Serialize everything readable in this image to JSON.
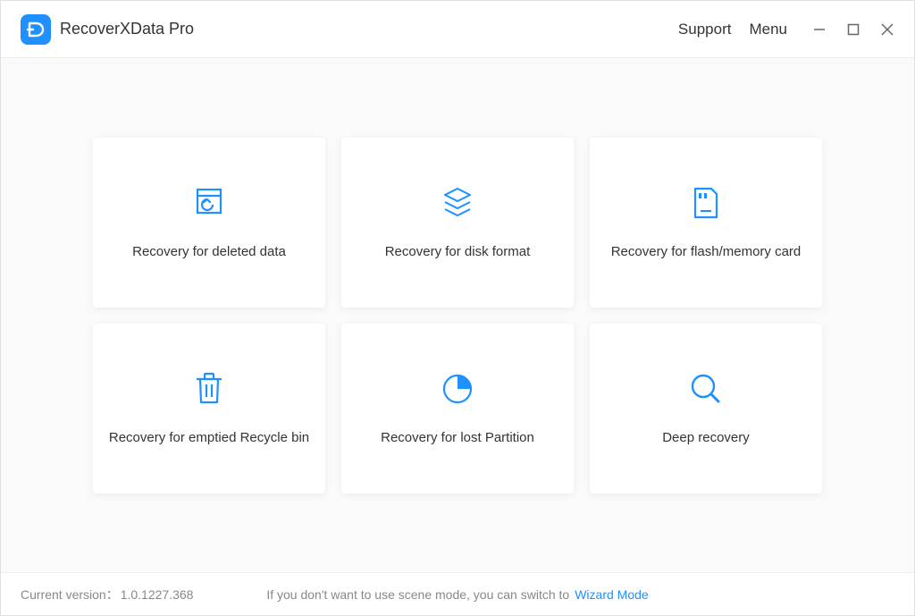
{
  "app": {
    "title": "RecoverXData Pro"
  },
  "header": {
    "support": "Support",
    "menu": "Menu"
  },
  "cards": [
    {
      "label": "Recovery for deleted data",
      "icon": "restore-file-icon"
    },
    {
      "label": "Recovery for disk format",
      "icon": "layers-icon"
    },
    {
      "label": "Recovery for flash/memory card",
      "icon": "sd-card-icon"
    },
    {
      "label": "Recovery for emptied Recycle bin",
      "icon": "trash-icon"
    },
    {
      "label": "Recovery for lost Partition",
      "icon": "pie-icon"
    },
    {
      "label": "Deep recovery",
      "icon": "search-icon"
    }
  ],
  "footer": {
    "version_label": "Current version：",
    "version_value": "1.0.1227.368",
    "hint": "If you don't want to use scene mode, you can switch to",
    "wizard": "Wizard Mode"
  },
  "colors": {
    "accent": "#1E90FF"
  }
}
